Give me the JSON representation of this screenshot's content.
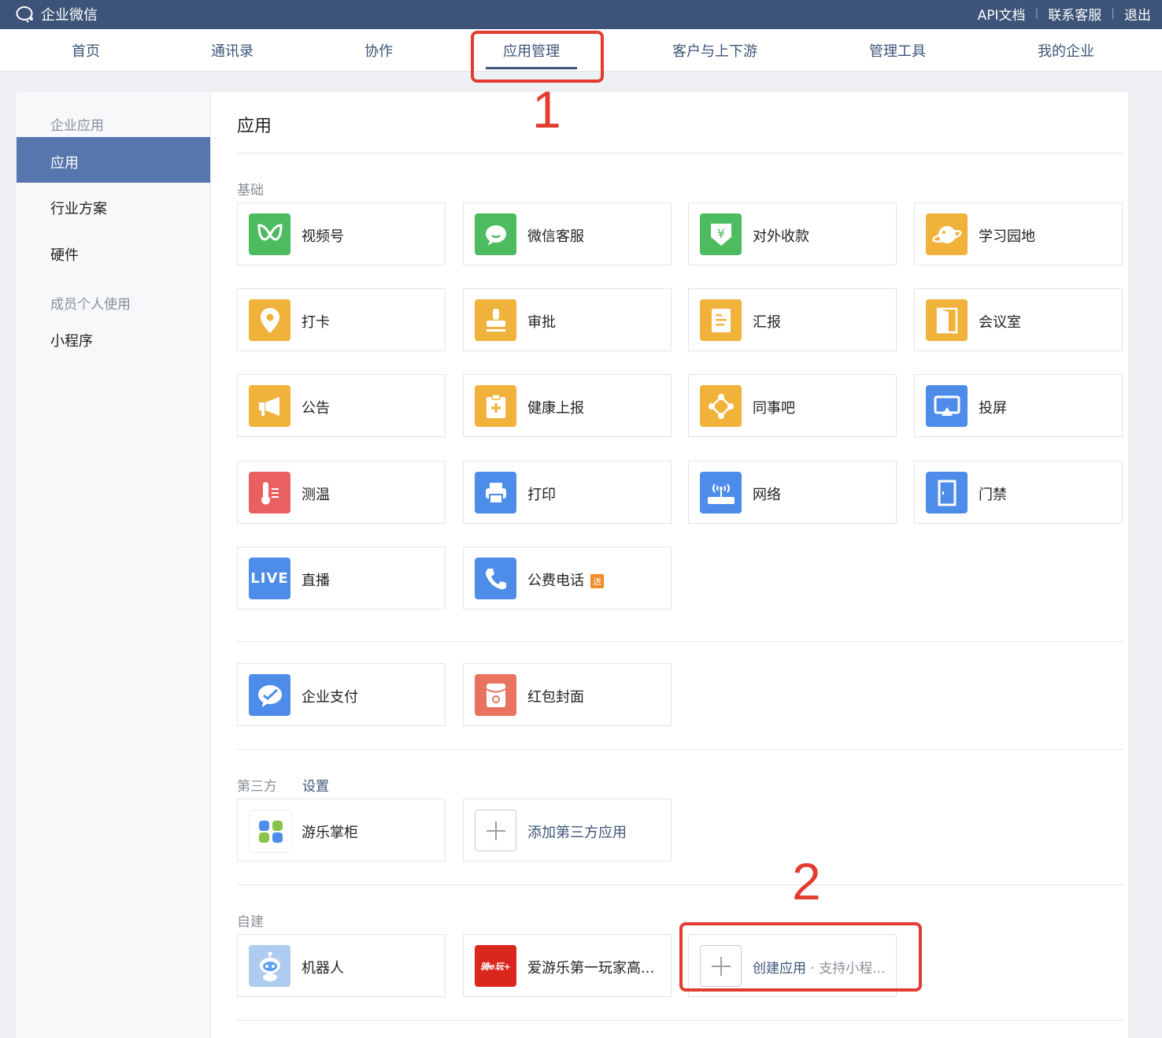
{
  "topbar": {
    "brand": "企业微信",
    "links": [
      "API文档",
      "联系客服",
      "退出"
    ]
  },
  "nav": [
    "首页",
    "通讯录",
    "协作",
    "应用管理",
    "客户与上下游",
    "管理工具",
    "我的企业"
  ],
  "nav_active": "应用管理",
  "annotations": [
    "1",
    "2"
  ],
  "sidebar": {
    "group1": "企业应用",
    "items1": [
      "应用",
      "行业方案",
      "硬件"
    ],
    "group2": "成员个人使用",
    "items2": [
      "小程序"
    ]
  },
  "main": {
    "title": "应用",
    "basic_label": "基础",
    "basic_apps": [
      {
        "label": "视频号",
        "icon": "channels-icon",
        "color": "#4dbb5f"
      },
      {
        "label": "微信客服",
        "icon": "wechat-service-icon",
        "color": "#4dbb5f"
      },
      {
        "label": "对外收款",
        "icon": "payment-shield-icon",
        "color": "#4dbb5f"
      },
      {
        "label": "学习园地",
        "icon": "planet-icon",
        "color": "#f0b23a"
      },
      {
        "label": "打卡",
        "icon": "location-pin-icon",
        "color": "#f0b23a"
      },
      {
        "label": "审批",
        "icon": "stamp-icon",
        "color": "#f0b23a"
      },
      {
        "label": "汇报",
        "icon": "report-doc-icon",
        "color": "#f0b23a"
      },
      {
        "label": "会议室",
        "icon": "door-icon",
        "color": "#f0b23a"
      },
      {
        "label": "公告",
        "icon": "megaphone-icon",
        "color": "#f0b23a"
      },
      {
        "label": "健康上报",
        "icon": "health-clipboard-icon",
        "color": "#f0b23a"
      },
      {
        "label": "同事吧",
        "icon": "network-nodes-icon",
        "color": "#f0b23a"
      },
      {
        "label": "投屏",
        "icon": "screen-cast-icon",
        "color": "#4d8ce8"
      },
      {
        "label": "测温",
        "icon": "thermometer-icon",
        "color": "#ea6060"
      },
      {
        "label": "打印",
        "icon": "printer-icon",
        "color": "#4d8ce8"
      },
      {
        "label": "网络",
        "icon": "router-icon",
        "color": "#4d8ce8"
      },
      {
        "label": "门禁",
        "icon": "access-door-icon",
        "color": "#4d8ce8"
      },
      {
        "label": "直播",
        "icon": "live-icon",
        "color": "#4d8ce8",
        "icon_text": "LIVE"
      },
      {
        "label": "公费电话",
        "icon": "phone-icon",
        "color": "#4d8ce8",
        "badge": "送"
      }
    ],
    "pay_apps": [
      {
        "label": "企业支付",
        "icon": "enterprise-pay-icon",
        "color": "#4d8ce8"
      },
      {
        "label": "红包封面",
        "icon": "red-packet-icon",
        "color": "#e8735f"
      }
    ],
    "third_label": "第三方",
    "third_settings": "设置",
    "third_apps": [
      {
        "label": "游乐掌柜",
        "icon": "youle-logo-icon"
      },
      {
        "label": "添加第三方应用",
        "icon": "plus-icon"
      }
    ],
    "self_label": "自建",
    "self_apps": [
      {
        "label": "机器人",
        "icon": "robot-icon"
      },
      {
        "label": "爱游乐第一玩家高...",
        "icon": "aiyoule-logo-icon",
        "icon_text": "骑e玩+"
      }
    ],
    "create_app": {
      "label": "创建应用",
      "sub": " · 支持小程..."
    }
  }
}
